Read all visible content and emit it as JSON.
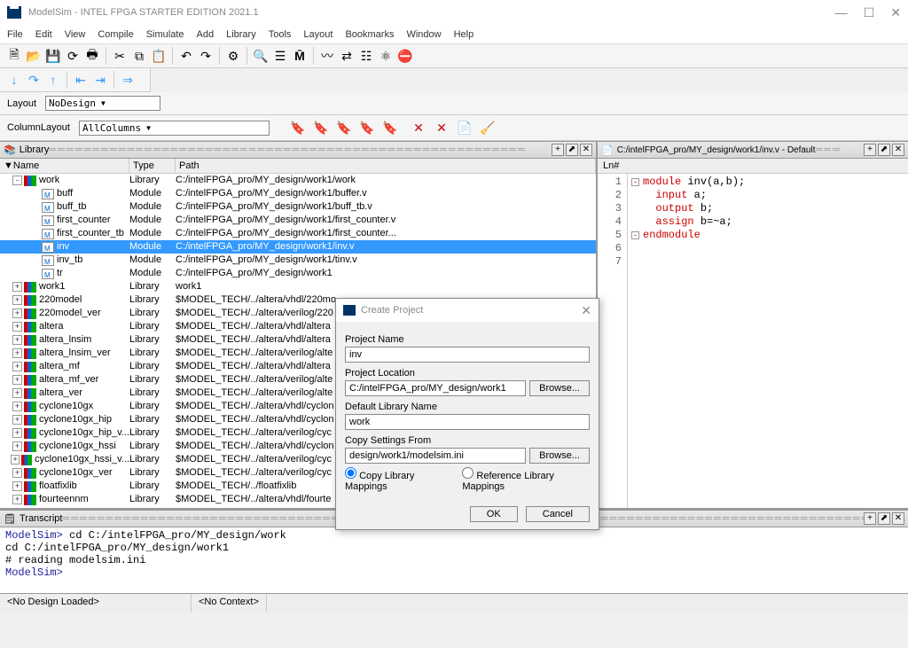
{
  "window": {
    "title": "ModelSim - INTEL FPGA STARTER EDITION 2021.1"
  },
  "menu": [
    "File",
    "Edit",
    "View",
    "Compile",
    "Simulate",
    "Add",
    "Library",
    "Tools",
    "Layout",
    "Bookmarks",
    "Window",
    "Help"
  ],
  "layout": {
    "layout_label": "Layout",
    "layout_value": "NoDesign",
    "column_label": "ColumnLayout",
    "column_value": "AllColumns"
  },
  "library": {
    "title": "Library",
    "cols": {
      "name": "Name",
      "type": "Type",
      "path": "Path"
    },
    "rows": [
      {
        "lvl": 1,
        "exp": "-",
        "icon": "books",
        "name": "work",
        "type": "Library",
        "path": "C:/intelFPGA_pro/MY_design/work1/work",
        "sel": false
      },
      {
        "lvl": 2,
        "exp": "",
        "icon": "mod",
        "name": "buff",
        "type": "Module",
        "path": "C:/intelFPGA_pro/MY_design/work1/buffer.v",
        "sel": false
      },
      {
        "lvl": 2,
        "exp": "",
        "icon": "mod",
        "name": "buff_tb",
        "type": "Module",
        "path": "C:/intelFPGA_pro/MY_design/work1/buff_tb.v",
        "sel": false
      },
      {
        "lvl": 2,
        "exp": "",
        "icon": "mod",
        "name": "first_counter",
        "type": "Module",
        "path": "C:/intelFPGA_pro/MY_design/work1/first_counter.v",
        "sel": false
      },
      {
        "lvl": 2,
        "exp": "",
        "icon": "mod",
        "name": "first_counter_tb",
        "type": "Module",
        "path": "C:/intelFPGA_pro/MY_design/work1/first_counter...",
        "sel": false
      },
      {
        "lvl": 2,
        "exp": "",
        "icon": "mod",
        "name": "inv",
        "type": "Module",
        "path": "C:/intelFPGA_pro/MY_design/work1/inv.v",
        "sel": true
      },
      {
        "lvl": 2,
        "exp": "",
        "icon": "mod",
        "name": "inv_tb",
        "type": "Module",
        "path": "C:/intelFPGA_pro/MY_design/work1/tinv.v",
        "sel": false
      },
      {
        "lvl": 2,
        "exp": "",
        "icon": "mod",
        "name": "tr",
        "type": "Module",
        "path": "C:/intelFPGA_pro/MY_design/work1",
        "sel": false
      },
      {
        "lvl": 1,
        "exp": "+",
        "icon": "books",
        "name": "work1",
        "type": "Library",
        "path": "work1",
        "sel": false
      },
      {
        "lvl": 1,
        "exp": "+",
        "icon": "books",
        "name": "220model",
        "type": "Library",
        "path": "$MODEL_TECH/../altera/vhdl/220mo",
        "sel": false
      },
      {
        "lvl": 1,
        "exp": "+",
        "icon": "books",
        "name": "220model_ver",
        "type": "Library",
        "path": "$MODEL_TECH/../altera/verilog/220",
        "sel": false
      },
      {
        "lvl": 1,
        "exp": "+",
        "icon": "books",
        "name": "altera",
        "type": "Library",
        "path": "$MODEL_TECH/../altera/vhdl/altera",
        "sel": false
      },
      {
        "lvl": 1,
        "exp": "+",
        "icon": "books",
        "name": "altera_lnsim",
        "type": "Library",
        "path": "$MODEL_TECH/../altera/vhdl/altera",
        "sel": false
      },
      {
        "lvl": 1,
        "exp": "+",
        "icon": "books",
        "name": "altera_lnsim_ver",
        "type": "Library",
        "path": "$MODEL_TECH/../altera/verilog/alte",
        "sel": false
      },
      {
        "lvl": 1,
        "exp": "+",
        "icon": "books",
        "name": "altera_mf",
        "type": "Library",
        "path": "$MODEL_TECH/../altera/vhdl/altera",
        "sel": false
      },
      {
        "lvl": 1,
        "exp": "+",
        "icon": "books",
        "name": "altera_mf_ver",
        "type": "Library",
        "path": "$MODEL_TECH/../altera/verilog/alte",
        "sel": false
      },
      {
        "lvl": 1,
        "exp": "+",
        "icon": "books",
        "name": "altera_ver",
        "type": "Library",
        "path": "$MODEL_TECH/../altera/verilog/alte",
        "sel": false
      },
      {
        "lvl": 1,
        "exp": "+",
        "icon": "books",
        "name": "cyclone10gx",
        "type": "Library",
        "path": "$MODEL_TECH/../altera/vhdl/cyclon",
        "sel": false
      },
      {
        "lvl": 1,
        "exp": "+",
        "icon": "books",
        "name": "cyclone10gx_hip",
        "type": "Library",
        "path": "$MODEL_TECH/../altera/vhdl/cyclon",
        "sel": false
      },
      {
        "lvl": 1,
        "exp": "+",
        "icon": "books",
        "name": "cyclone10gx_hip_v...",
        "type": "Library",
        "path": "$MODEL_TECH/../altera/verilog/cyc",
        "sel": false
      },
      {
        "lvl": 1,
        "exp": "+",
        "icon": "books",
        "name": "cyclone10gx_hssi",
        "type": "Library",
        "path": "$MODEL_TECH/../altera/vhdl/cyclon",
        "sel": false
      },
      {
        "lvl": 1,
        "exp": "+",
        "icon": "books",
        "name": "cyclone10gx_hssi_v...",
        "type": "Library",
        "path": "$MODEL_TECH/../altera/verilog/cyc",
        "sel": false
      },
      {
        "lvl": 1,
        "exp": "+",
        "icon": "books",
        "name": "cyclone10gx_ver",
        "type": "Library",
        "path": "$MODEL_TECH/../altera/verilog/cyc",
        "sel": false
      },
      {
        "lvl": 1,
        "exp": "+",
        "icon": "books",
        "name": "floatfixlib",
        "type": "Library",
        "path": "$MODEL_TECH/../floatfixlib",
        "sel": false
      },
      {
        "lvl": 1,
        "exp": "+",
        "icon": "books",
        "name": "fourteennm",
        "type": "Library",
        "path": "$MODEL_TECH/../altera/vhdl/fourte",
        "sel": false
      }
    ]
  },
  "editor": {
    "title": "C:/intelFPGA_pro/MY_design/work1/inv.v - Default",
    "ln_label": "Ln#",
    "lines": [
      {
        "n": 1,
        "fold": "-",
        "pre": "",
        "kw": "module",
        "rest": " inv(a,b);"
      },
      {
        "n": 2,
        "fold": "",
        "pre": "  ",
        "kw": "input",
        "rest": " a;"
      },
      {
        "n": 3,
        "fold": "",
        "pre": "  ",
        "kw": "output",
        "rest": " b;"
      },
      {
        "n": 4,
        "fold": "",
        "pre": "  ",
        "kw": "assign",
        "rest": " b=~a;"
      },
      {
        "n": 5,
        "fold": "-",
        "pre": "",
        "kw": "endmodule",
        "rest": ""
      },
      {
        "n": 6,
        "fold": "",
        "pre": "",
        "kw": "",
        "rest": ""
      },
      {
        "n": 7,
        "fold": "",
        "pre": "",
        "kw": "",
        "rest": ""
      }
    ]
  },
  "dialog": {
    "title": "Create Project",
    "project_name_label": "Project Name",
    "project_name_value": "inv",
    "project_loc_label": "Project Location",
    "project_loc_value": "C:/intelFPGA_pro/MY_design/work1",
    "browse": "Browse...",
    "default_lib_label": "Default Library Name",
    "default_lib_value": "work",
    "copy_settings_label": "Copy Settings From",
    "copy_settings_value": "design/work1/modelsim.ini",
    "radio_copy": "Copy Library Mappings",
    "radio_ref": "Reference Library Mappings",
    "ok": "OK",
    "cancel": "Cancel"
  },
  "transcript": {
    "title": "Transcript",
    "lines": [
      {
        "prompt": "ModelSim> ",
        "text": "cd C:/intelFPGA_pro/MY_design/work"
      },
      {
        "prompt": "",
        "text": "cd C:/intelFPGA_pro/MY_design/work1"
      },
      {
        "prompt": "",
        "text": "# reading modelsim.ini"
      },
      {
        "prompt": "",
        "text": ""
      },
      {
        "prompt": "ModelSim> ",
        "text": ""
      }
    ]
  },
  "status": {
    "left": "<No Design Loaded>",
    "center": "<No Context>"
  }
}
